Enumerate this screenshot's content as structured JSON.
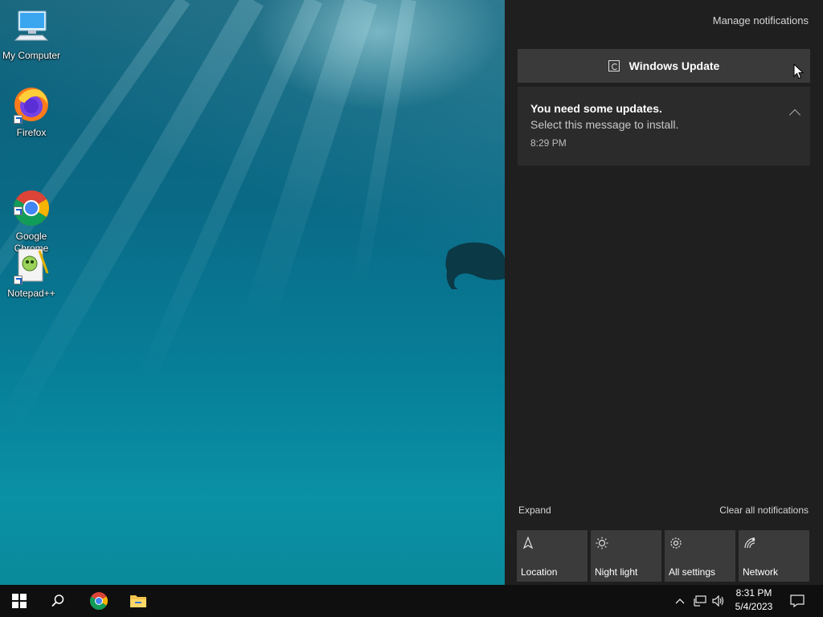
{
  "desktop": {
    "icons": [
      {
        "label": "My Computer",
        "icon": "my-computer-icon"
      },
      {
        "label": "Firefox",
        "icon": "firefox-icon"
      },
      {
        "label": "Google\nChrome",
        "icon": "chrome-icon"
      },
      {
        "label": "Notepad++",
        "icon": "notepadpp-icon"
      }
    ]
  },
  "action_center": {
    "manage_notifications": "Manage notifications",
    "group_title": "Windows Update",
    "notification": {
      "title": "You need some updates.",
      "body": "Select this message to install.",
      "time": "8:29 PM"
    },
    "expand": "Expand",
    "clear_all": "Clear all notifications",
    "quick_actions": [
      {
        "label": "Location",
        "icon": "location-icon"
      },
      {
        "label": "Night light",
        "icon": "night-light-icon"
      },
      {
        "label": "All settings",
        "icon": "gear-icon"
      },
      {
        "label": "Network",
        "icon": "network-icon"
      }
    ]
  },
  "taskbar": {
    "time": "8:31 PM",
    "date": "5/4/2023"
  },
  "colors": {
    "panel_bg": "#1f1f1f",
    "tile_bg": "#3b3b3b",
    "taskbar_bg": "#0f0f0f"
  }
}
